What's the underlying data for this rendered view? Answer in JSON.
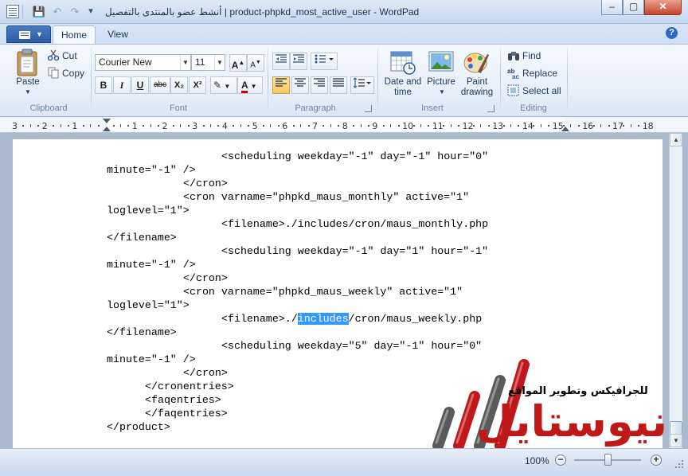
{
  "window": {
    "title": "أنشط عضو بالمنتدى بالتفصيل | product-phpkd_most_active_user - WordPad",
    "minimize_glyph": "‒",
    "maximize_glyph": "▢",
    "close_glyph": "✕"
  },
  "quick_access": {
    "save_glyph": "💾",
    "undo_glyph": "↶",
    "redo_glyph": "↷",
    "customize_glyph": "▾"
  },
  "ribbon": {
    "tabs": [
      {
        "label": "Home",
        "active": true
      },
      {
        "label": "View",
        "active": false
      }
    ],
    "help_glyph": "?",
    "clipboard": {
      "label": "Clipboard",
      "paste": "Paste",
      "cut": "Cut",
      "copy": "Copy"
    },
    "font": {
      "label": "Font",
      "family": "Courier New",
      "size": "11",
      "grow_glyph": "A",
      "shrink_glyph": "A",
      "bold": "B",
      "italic": "I",
      "underline": "U",
      "strikethrough": "abc",
      "subscript": "X₂",
      "superscript": "X²",
      "highlight_glyph": "✎",
      "color_glyph": "A"
    },
    "paragraph": {
      "label": "Paragraph"
    },
    "insert": {
      "label": "Insert",
      "date_time": "Date and\ntime",
      "picture": "Picture",
      "paint_drawing": "Paint\ndrawing"
    },
    "editing": {
      "label": "Editing",
      "find": "Find",
      "replace": "Replace",
      "select_all": "Select all"
    }
  },
  "ruler": {
    "labels": [
      "3",
      "2",
      "1",
      "",
      "1",
      "2",
      "3",
      "4",
      "5",
      "6",
      "7",
      "8",
      "9",
      "10",
      "11",
      "12",
      "13",
      "14",
      "15",
      "16",
      "17",
      "18"
    ]
  },
  "document": {
    "lines": [
      {
        "text": "<scheduling weekday=\"-1\" day=\"-1\" hour=\"0\"",
        "indent": 3
      },
      {
        "text": "minute=\"-1\" />",
        "indent": 0
      },
      {
        "text": "</cron>",
        "indent": 2
      },
      {
        "text": "<cron varname=\"phpkd_maus_monthly\" active=\"1\"",
        "indent": 2
      },
      {
        "text": "loglevel=\"1\">",
        "indent": 0
      },
      {
        "text": "<filename>./includes/cron/maus_monthly.php",
        "indent": 3
      },
      {
        "text": "</filename>",
        "indent": 0
      },
      {
        "text": "<scheduling weekday=\"-1\" day=\"1\" hour=\"-1\"",
        "indent": 3
      },
      {
        "text": "minute=\"-1\" />",
        "indent": 0
      },
      {
        "text": "</cron>",
        "indent": 2
      },
      {
        "text": "<cron varname=\"phpkd_maus_weekly\" active=\"1\"",
        "indent": 2
      },
      {
        "text": "loglevel=\"1\">",
        "indent": 0
      },
      {
        "text_before": "<filename>./",
        "selected": "includes",
        "text_after": "/cron/maus_weekly.php",
        "indent": 3
      },
      {
        "text": "</filename>",
        "indent": 0
      },
      {
        "text": "<scheduling weekday=\"5\" day=\"-1\" hour=\"0\"",
        "indent": 3
      },
      {
        "text": "minute=\"-1\" />",
        "indent": 0
      },
      {
        "text": "</cron>",
        "indent": 2
      },
      {
        "text": "</cronentries>",
        "indent": 1
      },
      {
        "text": "<faqentries>",
        "indent": 1
      },
      {
        "text": "</faqentries>",
        "indent": 1
      },
      {
        "text": "</product>",
        "indent": 0
      }
    ]
  },
  "statusbar": {
    "zoom": "100%",
    "zoom_out": "−",
    "zoom_in": "+"
  },
  "watermark": {
    "tagline": "للجرافيكس وتطوير المواقع",
    "name": "نيوستايل"
  },
  "colors": {
    "selection": "#3399ff",
    "watermark_red": "#c01818",
    "accent_blue": "#2a5aa5"
  }
}
